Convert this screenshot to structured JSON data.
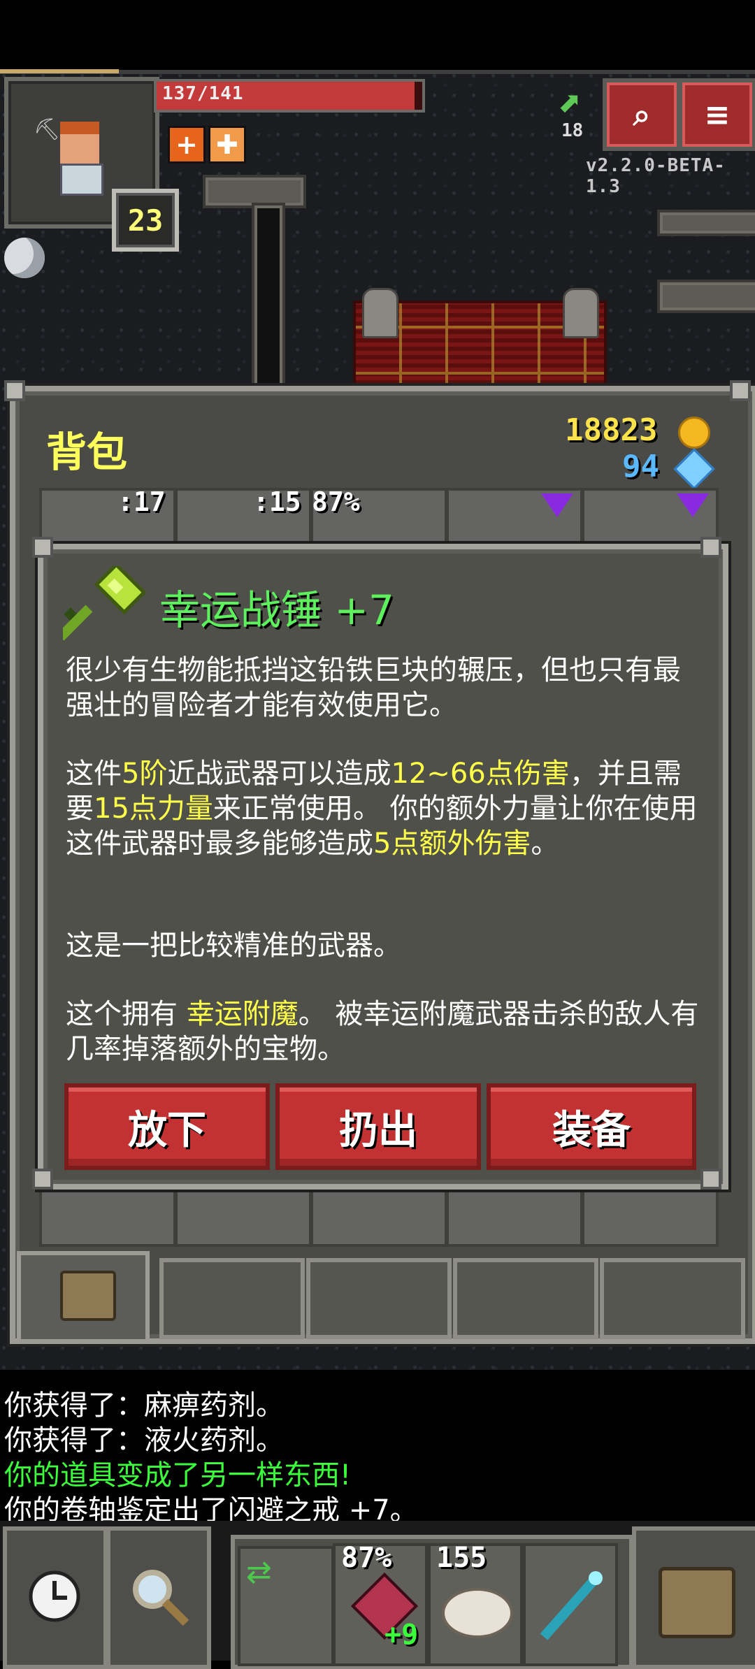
{
  "hud": {
    "hp_text": "137/141",
    "hp_fraction": 0.97,
    "level": "23",
    "depth": "18",
    "version": "v2.2.0-BETA-1.3",
    "journal_icon": "magnifier-book-icon",
    "menu_icon": "menu-icon"
  },
  "backpack": {
    "title": "背包",
    "gold": "18823",
    "gems": "94",
    "slot_labels": [
      ":17",
      ":15",
      "87%"
    ]
  },
  "item": {
    "name": "幸运战锤 +7",
    "icon": "warhammer-icon",
    "desc1": "很少有生物能抵挡这铅铁巨块的辗压，但也只有最强壮的冒险者才能有效使用它。",
    "desc2_a": "这件",
    "desc2_tier": "5阶",
    "desc2_b": "近战武器可以造成",
    "desc2_dmg": "12~66点伤害",
    "desc2_c": "，并且需要",
    "desc2_str": "15点力量",
    "desc2_d": "来正常使用。 你的额外力量让你在使用这件武器时最多能够造成",
    "desc2_extra": "5点额外伤害",
    "desc2_e": "。",
    "desc3": "这是一把比较精准的武器。",
    "desc4_a": "这个拥有 ",
    "desc4_ench": "幸运附魔",
    "desc4_b": "。 被幸运附魔武器击杀的敌人有几率掉落额外的宝物。",
    "buttons": {
      "drop": "放下",
      "throw": "扔出",
      "equip": "装备"
    }
  },
  "log": [
    "你获得了：麻痹药剂。",
    "你获得了：液火药剂。",
    "你的道具变成了另一样东西!",
    "你的卷轴鉴定出了闪避之戒 +7。"
  ],
  "toolbar": {
    "quickslot_1_label": "87%",
    "quickslot_1_level": "+9",
    "quickslot_2_label": "155"
  },
  "colors": {
    "accent_red": "#c23232",
    "title_green": "#5df25d",
    "highlight_yellow": "#ffff4a",
    "log_green": "#3cff3c"
  }
}
